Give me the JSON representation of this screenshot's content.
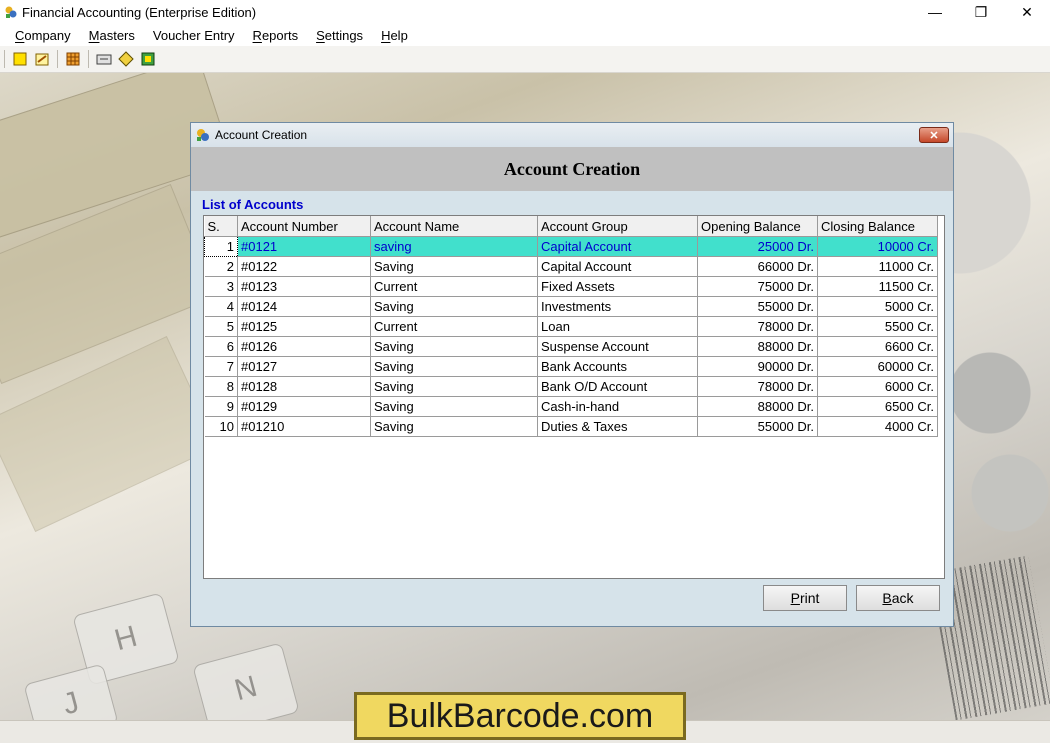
{
  "window": {
    "title": "Financial Accounting (Enterprise Edition)",
    "minimize": "—",
    "maximize": "❐",
    "close": "✕"
  },
  "menu": [
    {
      "first": "C",
      "rest": "ompany"
    },
    {
      "first": "M",
      "rest": "asters"
    },
    {
      "first": "",
      "rest": "Voucher Entry"
    },
    {
      "first": "R",
      "rest": "eports"
    },
    {
      "first": "S",
      "rest": "ettings"
    },
    {
      "first": "H",
      "rest": "elp"
    }
  ],
  "toolbar": {
    "icons": [
      "new-company-icon",
      "open-company-icon",
      "calculator-icon",
      "voucher-icon",
      "ledger-icon",
      "export-icon"
    ]
  },
  "dialog": {
    "title": "Account Creation",
    "heading": "Account Creation",
    "list_label": "List of Accounts",
    "columns": [
      "S.",
      "Account Number",
      "Account Name",
      "Account Group",
      "Opening Balance",
      "Closing Balance"
    ],
    "rows": [
      {
        "sno": "1",
        "number": "#0121",
        "name": "saving",
        "group": "Capital Account",
        "opening": "25000 Dr.",
        "closing": "10000 Cr."
      },
      {
        "sno": "2",
        "number": "#0122",
        "name": "Saving",
        "group": "Capital Account",
        "opening": "66000 Dr.",
        "closing": "11000 Cr."
      },
      {
        "sno": "3",
        "number": "#0123",
        "name": "Current",
        "group": "Fixed Assets",
        "opening": "75000 Dr.",
        "closing": "11500 Cr."
      },
      {
        "sno": "4",
        "number": "#0124",
        "name": "Saving",
        "group": "Investments",
        "opening": "55000 Dr.",
        "closing": "5000 Cr."
      },
      {
        "sno": "5",
        "number": "#0125",
        "name": "Current",
        "group": "Loan",
        "opening": "78000 Dr.",
        "closing": "5500 Cr."
      },
      {
        "sno": "6",
        "number": "#0126",
        "name": "Saving",
        "group": "Suspense Account",
        "opening": "88000 Dr.",
        "closing": "6600 Cr."
      },
      {
        "sno": "7",
        "number": "#0127",
        "name": "Saving",
        "group": "Bank Accounts",
        "opening": "90000 Dr.",
        "closing": "60000 Cr."
      },
      {
        "sno": "8",
        "number": "#0128",
        "name": "Saving",
        "group": "Bank O/D Account",
        "opening": "78000 Dr.",
        "closing": "6000 Cr."
      },
      {
        "sno": "9",
        "number": "#0129",
        "name": "Saving",
        "group": "Cash-in-hand",
        "opening": "88000 Dr.",
        "closing": "6500 Cr."
      },
      {
        "sno": "10",
        "number": "#01210",
        "name": "Saving",
        "group": "Duties & Taxes",
        "opening": "55000 Dr.",
        "closing": "4000 Cr."
      }
    ],
    "print_first": "P",
    "print_rest": "rint",
    "back_first": "B",
    "back_rest": "ack"
  },
  "watermark": "BulkBarcode.com",
  "colors": {
    "selected_row": "#41e0cc",
    "selected_text": "#0000cc",
    "list_label": "#0000cc"
  }
}
